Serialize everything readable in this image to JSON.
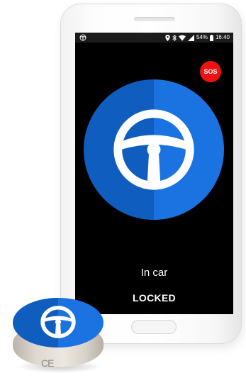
{
  "status_bar": {
    "battery": "54%",
    "time": "16:40",
    "icons": [
      "steering-wheel-icon",
      "location-pin-icon",
      "bluetooth-icon",
      "wifi-icon",
      "cellular-signal-icon"
    ]
  },
  "sos": {
    "label": "SOS",
    "color": "#ee1111"
  },
  "mode_button": {
    "icon": "steering-wheel-icon",
    "colors": {
      "left": "#0f5dbf",
      "right": "#1a73e0"
    }
  },
  "status": {
    "mode": "In car",
    "lock": "LOCKED"
  },
  "device": {
    "icon": "steering-wheel-icon",
    "mark": "CE"
  }
}
